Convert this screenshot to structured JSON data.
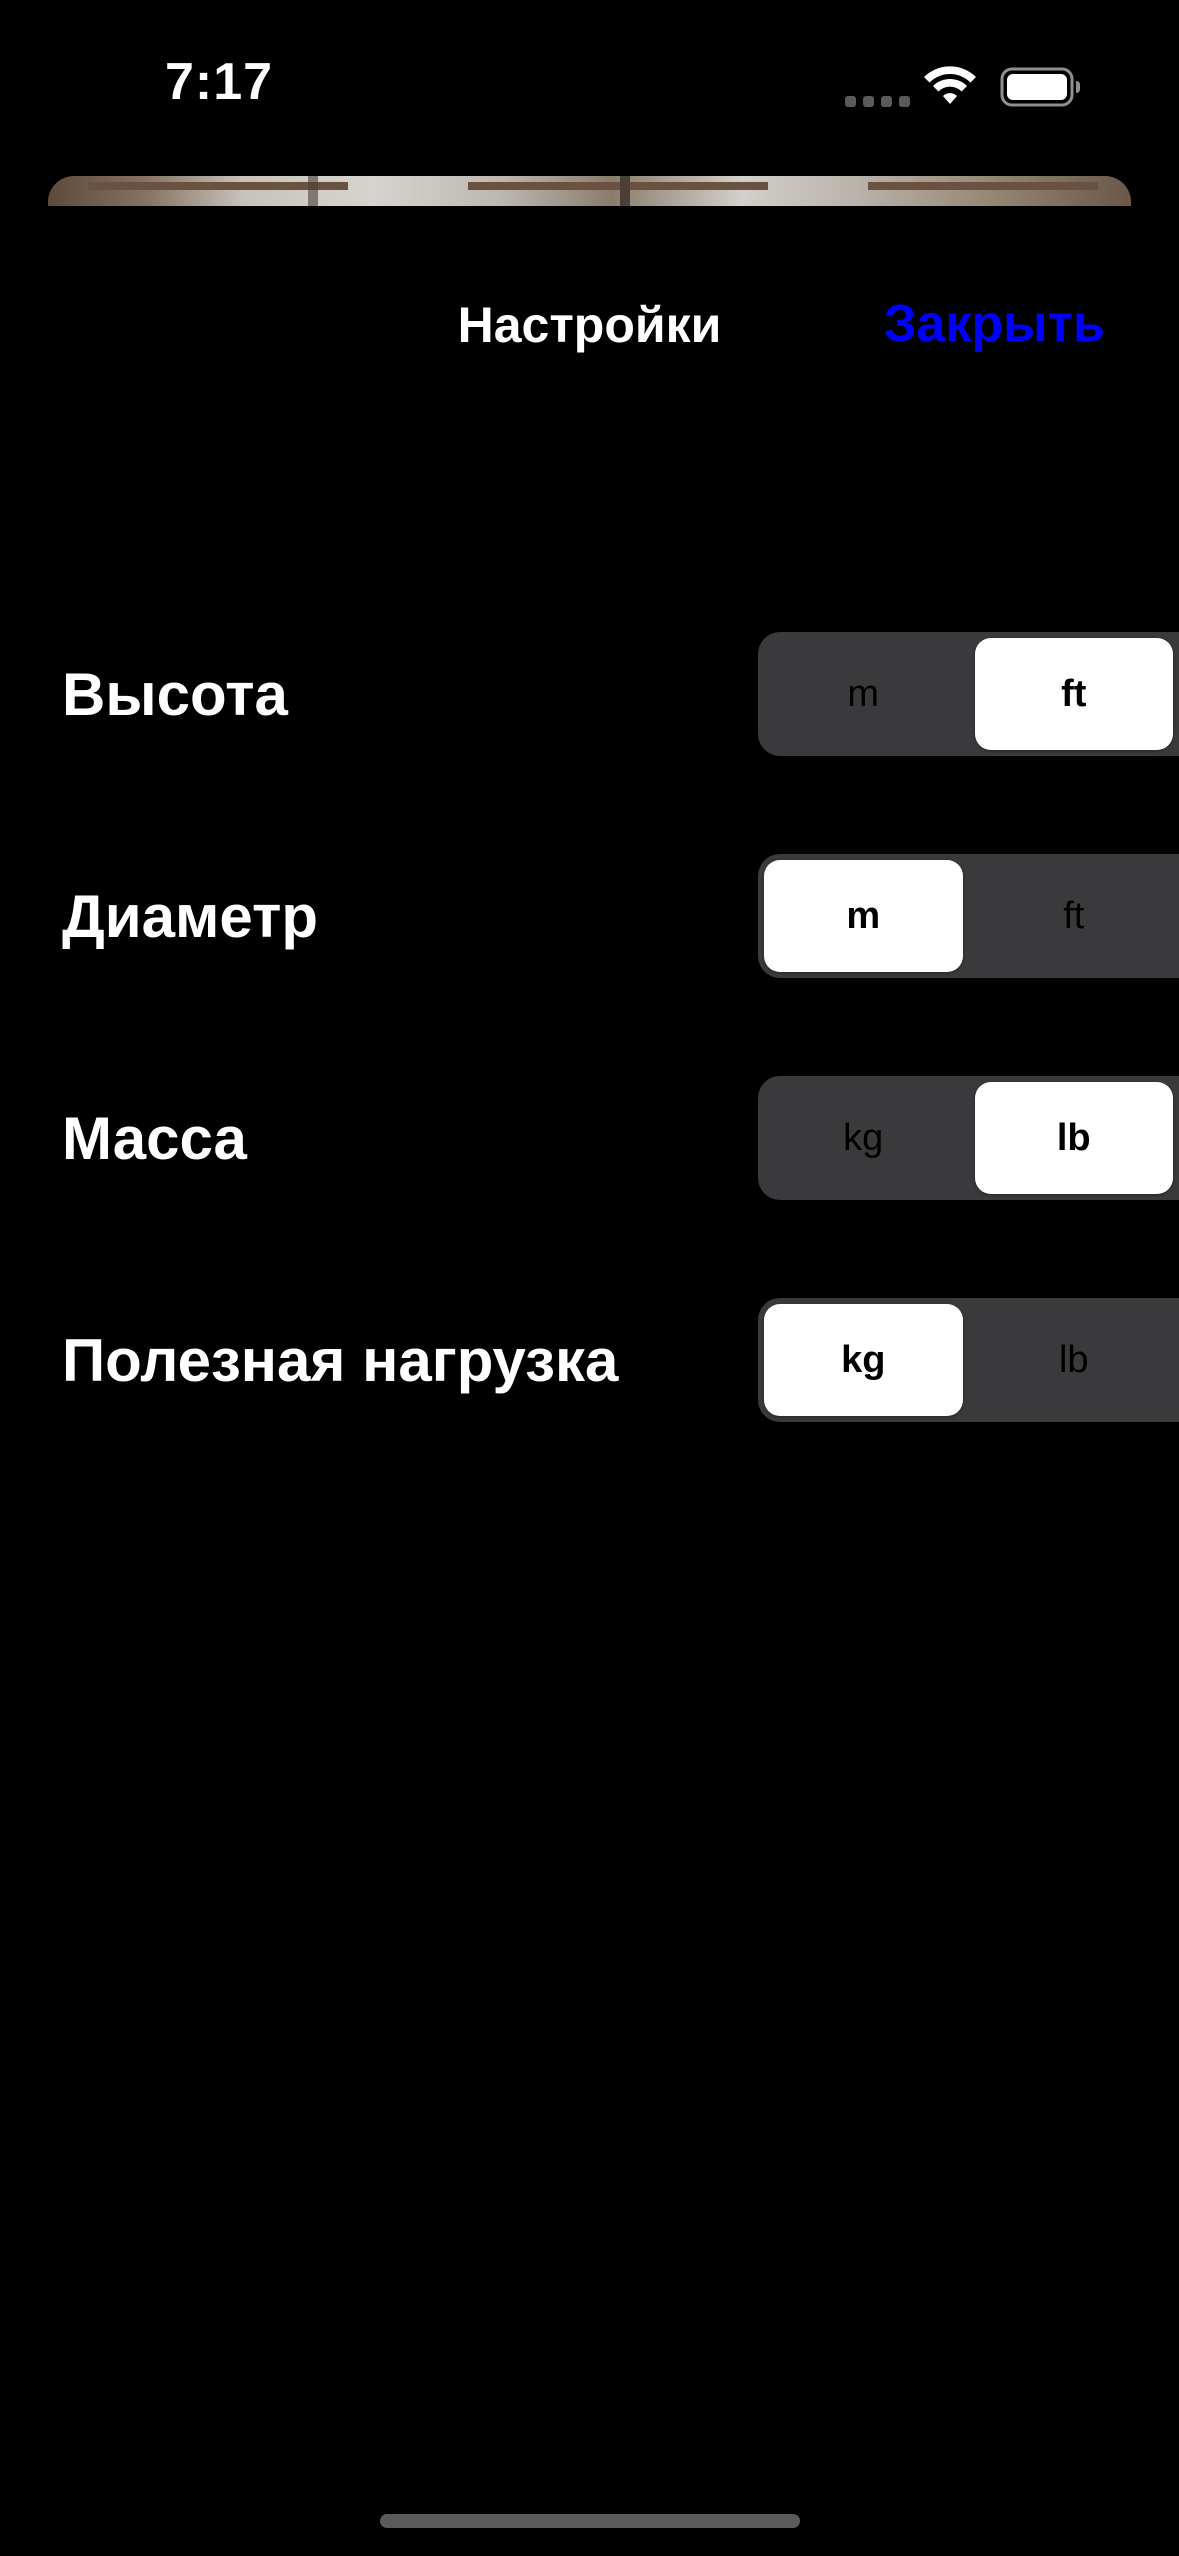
{
  "status_bar": {
    "time": "7:17",
    "icons": [
      "cellular-dots-icon",
      "wifi-icon",
      "battery-icon"
    ]
  },
  "nav": {
    "title": "Настройки",
    "close_label": "Закрыть",
    "close_color": "#0000ff"
  },
  "settings": [
    {
      "label": "Высота",
      "options": [
        "m",
        "ft"
      ],
      "selected": "ft"
    },
    {
      "label": "Диаметр",
      "options": [
        "m",
        "ft"
      ],
      "selected": "m"
    },
    {
      "label": "Масса",
      "options": [
        "kg",
        "lb"
      ],
      "selected": "lb"
    },
    {
      "label": "Полезная нагрузка",
      "options": [
        "kg",
        "lb"
      ],
      "selected": "kg"
    }
  ],
  "colors": {
    "background": "#000000",
    "segment_track": "#3a3a3c",
    "segment_selected": "#ffffff",
    "text": "#ffffff"
  }
}
